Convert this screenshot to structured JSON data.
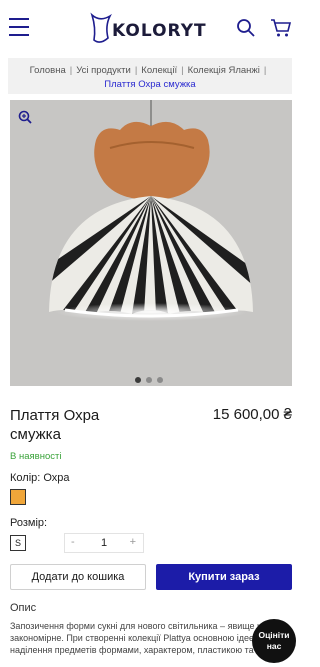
{
  "header": {
    "logo_text": "KOLORYT",
    "menu_icon": "hamburger-icon",
    "search_icon": "search-icon",
    "cart_icon": "cart-icon",
    "brand_color": "#1e1d8e"
  },
  "breadcrumb": {
    "items": [
      "Головна",
      "Усі продукти",
      "Колекції",
      "Колекція Яланжі"
    ],
    "current": "Плаття Охра смужка"
  },
  "gallery": {
    "zoom_icon": "zoom-in-icon",
    "dots": [
      true,
      false,
      false
    ]
  },
  "product": {
    "title": "Плаття Охра смужка",
    "price": "15 600,00 ₴",
    "stock": "В наявності",
    "color_label": "Колір: Охра",
    "color_value": "#f0a63a",
    "size_label": "Розмір:",
    "size_value": "S",
    "qty_minus": "-",
    "qty_value": "1",
    "qty_plus": "+"
  },
  "actions": {
    "add_to_cart": "Додати до кошика",
    "buy_now": "Купити зараз"
  },
  "description": {
    "heading": "Опис",
    "text": "Запозичення форми сукні для нового світильника – явище цілком закономірне. При створенні колекції Plattya основною ідеєю було наділення предметів формами, характером, пластикою та грацією"
  },
  "rate_button": "Оцініти нас"
}
